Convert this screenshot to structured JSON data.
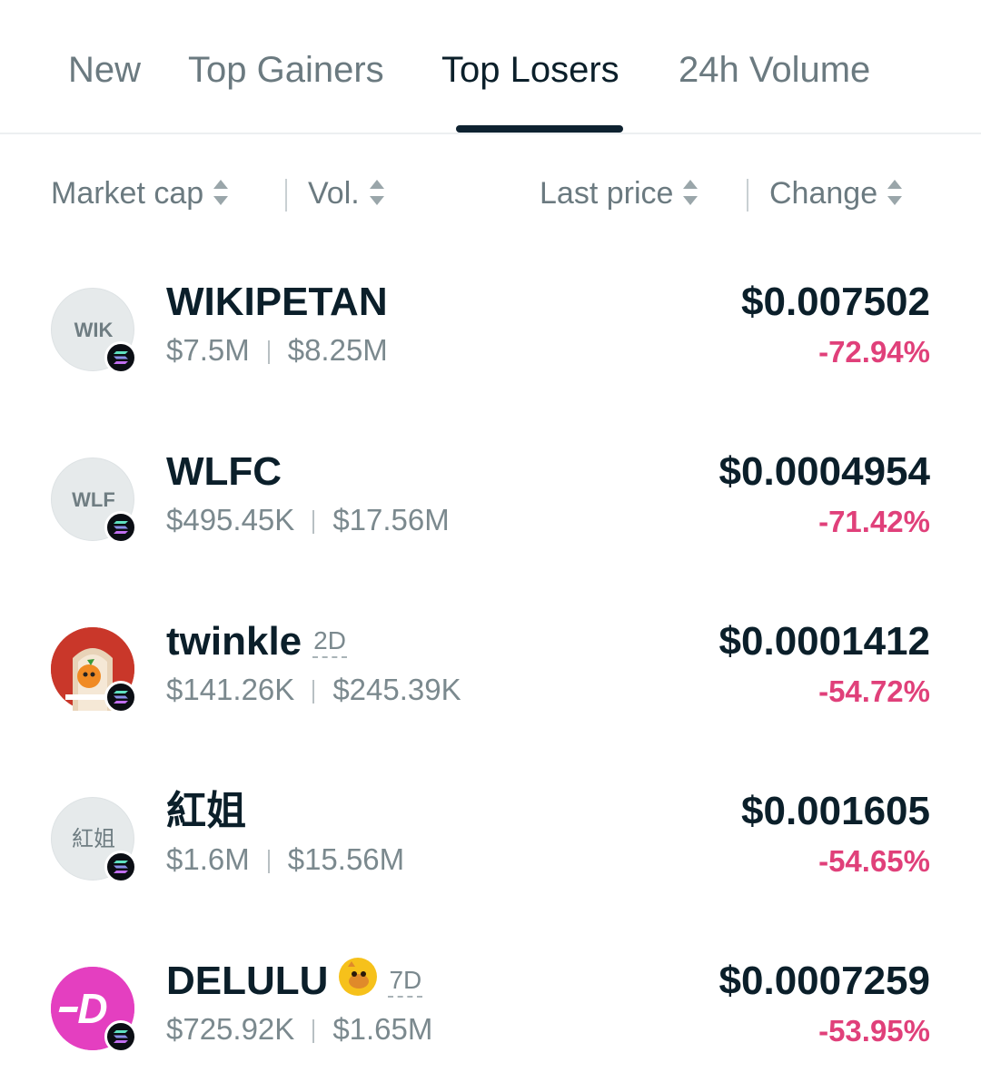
{
  "tabs": [
    {
      "label": "New",
      "active": false
    },
    {
      "label": "Top Gainers",
      "active": false
    },
    {
      "label": "Top Losers",
      "active": true
    },
    {
      "label": "24h Volume",
      "active": false
    }
  ],
  "sort": {
    "market_cap": "Market cap",
    "vol": "Vol.",
    "last_price": "Last price",
    "change": "Change"
  },
  "colors": {
    "negative": "#e0407a",
    "text_primary": "#0b1f2a",
    "text_secondary": "#7b898e",
    "tab_indicator": "#0e2230"
  },
  "tokens": [
    {
      "avatar_text": "WIK",
      "avatar_icon": "placeholder-avatar",
      "name": "WIKIPETAN",
      "age": "",
      "market_cap": "$7.5M",
      "volume": "$8.25M",
      "price": "$0.007502",
      "change": "-72.94%",
      "chain_icon": "solana-icon"
    },
    {
      "avatar_text": "WLF",
      "avatar_icon": "placeholder-avatar",
      "name": "WLFC",
      "age": "",
      "market_cap": "$495.45K",
      "volume": "$17.56M",
      "price": "$0.0004954",
      "change": "-71.42%",
      "chain_icon": "solana-icon"
    },
    {
      "avatar_text": "",
      "avatar_icon": "twinkle-logo",
      "name": "twinkle",
      "age": "2D",
      "market_cap": "$141.26K",
      "volume": "$245.39K",
      "price": "$0.0001412",
      "change": "-54.72%",
      "chain_icon": "solana-icon"
    },
    {
      "avatar_text": "紅姐",
      "avatar_icon": "placeholder-avatar",
      "name": "紅姐",
      "age": "",
      "market_cap": "$1.6M",
      "volume": "$15.56M",
      "price": "$0.001605",
      "change": "-54.65%",
      "chain_icon": "solana-icon"
    },
    {
      "avatar_text": "",
      "avatar_icon": "delulu-logo",
      "name": "DELULU",
      "age": "7D",
      "badge_icon": "meme-face-icon",
      "market_cap": "$725.92K",
      "volume": "$1.65M",
      "price": "$0.0007259",
      "change": "-53.95%",
      "chain_icon": "solana-icon"
    }
  ]
}
